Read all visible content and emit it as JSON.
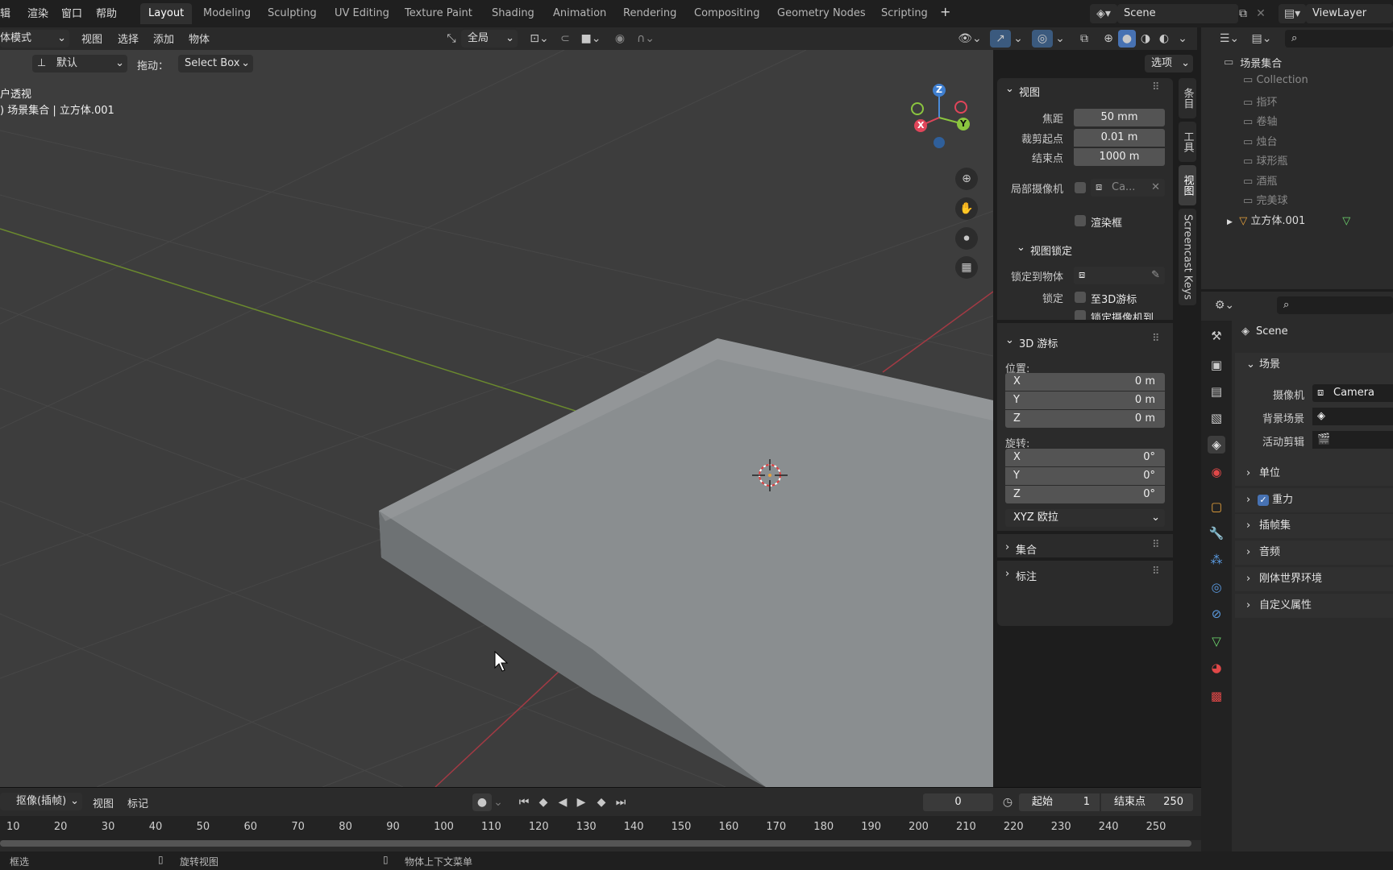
{
  "menus": [
    "辑",
    "渲染",
    "窗口",
    "帮助"
  ],
  "workspaces": [
    {
      "label": "Layout",
      "active": true
    },
    {
      "label": "Modeling"
    },
    {
      "label": "Sculpting"
    },
    {
      "label": "UV Editing"
    },
    {
      "label": "Texture Paint"
    },
    {
      "label": "Shading"
    },
    {
      "label": "Animation"
    },
    {
      "label": "Rendering"
    },
    {
      "label": "Compositing"
    },
    {
      "label": "Geometry Nodes"
    },
    {
      "label": "Scripting"
    }
  ],
  "add_workspace": "+",
  "scene": {
    "name": "Scene",
    "viewlayer": "ViewLayer"
  },
  "header": {
    "mode": "体模式",
    "menus": [
      "视图",
      "选择",
      "添加",
      "物体"
    ],
    "transform_orientation": "全局"
  },
  "tool_settings": {
    "orientation": "默认",
    "drag_label": "拖动：",
    "drag_value": "Select Box",
    "options": "选项"
  },
  "viewport_overlay": {
    "line1": "户透视",
    "line2": ") 场景集合 | 立方体.001"
  },
  "gizmo": {
    "x": "X",
    "y": "Y",
    "z": "Z"
  },
  "npanel": {
    "view_title": "视图",
    "focal_label": "焦距",
    "focal_value": "50 mm",
    "clip_start_label": "裁剪起点",
    "clip_start_value": "0.01 m",
    "clip_end_label": "结束点",
    "clip_end_value": "1000 m",
    "local_camera_label": "局部摄像机",
    "local_camera_value": "Ca...",
    "render_region_label": "渲染框",
    "view_lock_title": "视图锁定",
    "lock_object_label": "锁定到物体",
    "lock_label": "锁定",
    "lock_cursor_label": "至3D游标",
    "lock_camera_label": "锁定摄像机到...",
    "cursor_title": "3D 游标",
    "location_label": "位置:",
    "loc": [
      {
        "axis": "X",
        "value": "0 m"
      },
      {
        "axis": "Y",
        "value": "0 m"
      },
      {
        "axis": "Z",
        "value": "0 m"
      }
    ],
    "rotation_label": "旋转:",
    "rot": [
      {
        "axis": "X",
        "value": "0°"
      },
      {
        "axis": "Y",
        "value": "0°"
      },
      {
        "axis": "Z",
        "value": "0°"
      }
    ],
    "rotation_mode": "XYZ 欧拉",
    "collections_title": "集合",
    "annotations_title": "标注"
  },
  "side_tabs": [
    "条目",
    "工具",
    "视图",
    "Screencast Keys"
  ],
  "outliner": {
    "root": "场景集合",
    "items": [
      "Collection",
      "指环",
      "卷轴",
      "烛台",
      "球形瓶",
      "酒瓶",
      "完美球",
      "立方体.001"
    ]
  },
  "properties": {
    "scene_name": "Scene",
    "section_scene": "场景",
    "camera_label": "摄像机",
    "camera_value": "Camera",
    "bg_scene_label": "背景场景",
    "active_clip_label": "活动剪辑",
    "sections": [
      "单位",
      "重力",
      "插帧集",
      "音频",
      "刚体世界环境",
      "自定义属性"
    ]
  },
  "timeline": {
    "mode": "抠像(插帧)",
    "view": "视图",
    "marker": "标记",
    "current_frame": "0",
    "start_label": "起始",
    "start_value": "1",
    "end_label": "结束点",
    "end_value": "250",
    "ticks": [
      "10",
      "20",
      "30",
      "40",
      "50",
      "60",
      "70",
      "80",
      "90",
      "100",
      "110",
      "120",
      "130",
      "140",
      "150",
      "160",
      "170",
      "180",
      "190",
      "200",
      "210",
      "220",
      "230",
      "240",
      "250"
    ]
  },
  "status": {
    "left": "框选",
    "mid": "旋转视图",
    "right": "物体上下文菜单"
  }
}
